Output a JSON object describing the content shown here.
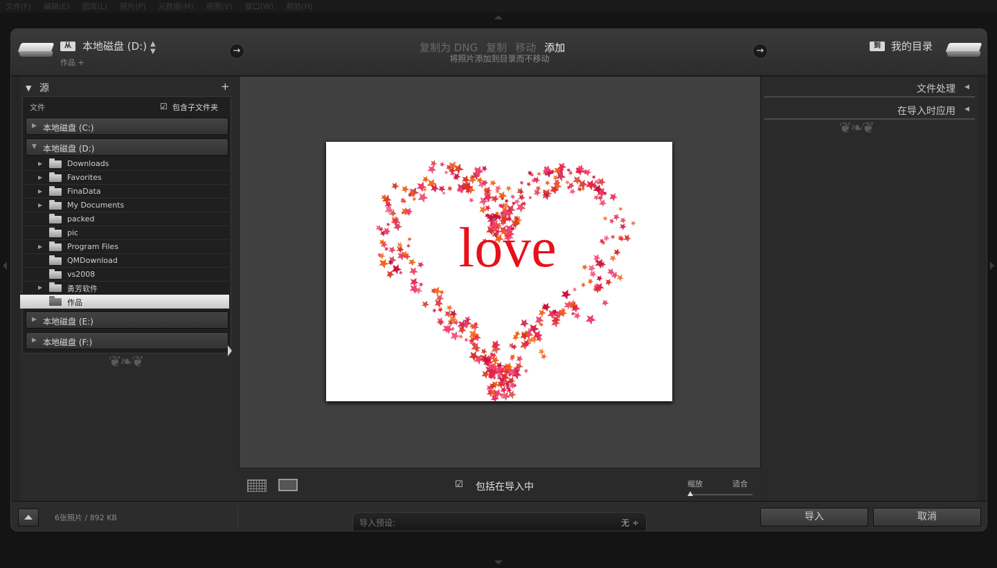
{
  "menu": [
    "文件(F)",
    "编辑(E)",
    "图库(L)",
    "照片(P)",
    "元数据(M)",
    "视图(V)",
    "窗口(W)",
    "帮助(H)"
  ],
  "header": {
    "source_badge": "从",
    "source_drive": "本地磁盘 (D:)",
    "source_folder": "作品 +",
    "modes": [
      "复制为 DNG",
      "复制",
      "移动",
      "添加"
    ],
    "active_mode": "添加",
    "mode_description": "将照片添加到目录而不移动",
    "dest_badge": "到",
    "dest_label": "我的目录"
  },
  "source_panel": {
    "title": "源",
    "files_label": "文件",
    "include_subfolders": "包含子文件夹",
    "drives": [
      {
        "label": "本地磁盘 (C:)",
        "expanded": false
      },
      {
        "label": "本地磁盘 (D:)",
        "expanded": true
      },
      {
        "label": "本地磁盘 (E:)",
        "expanded": false
      },
      {
        "label": "本地磁盘 (F:)",
        "expanded": false
      }
    ],
    "folders": [
      {
        "label": "Downloads",
        "has_children": true
      },
      {
        "label": "Favorites",
        "has_children": true
      },
      {
        "label": "FinaData",
        "has_children": true
      },
      {
        "label": "My Documents",
        "has_children": true
      },
      {
        "label": "packed",
        "has_children": false
      },
      {
        "label": "pic",
        "has_children": false
      },
      {
        "label": "Program Files",
        "has_children": true
      },
      {
        "label": "QMDownload",
        "has_children": false
      },
      {
        "label": "vs2008",
        "has_children": false
      },
      {
        "label": "勇芳软件",
        "has_children": true
      },
      {
        "label": "作品",
        "has_children": false,
        "selected": true
      }
    ]
  },
  "preview": {
    "image_text": "love",
    "include_label": "包括在导入中",
    "zoom_label": "缩放",
    "fit_label": "适合",
    "zoom_level": 0
  },
  "right_panel": {
    "sections": [
      "文件处理",
      "在导入时应用"
    ]
  },
  "footer": {
    "photo_count": "6张照片 / 892 KB",
    "preset_label": "导入预设:",
    "preset_value": "无 ÷",
    "import_button": "导入",
    "cancel_button": "取消"
  },
  "colors": {
    "background": "#141414",
    "panel": "#2a2a2a",
    "preview_area": "#404040",
    "love_text": "#e8101a",
    "leaf_primary": "#e8204a",
    "leaf_secondary": "#f06010"
  }
}
